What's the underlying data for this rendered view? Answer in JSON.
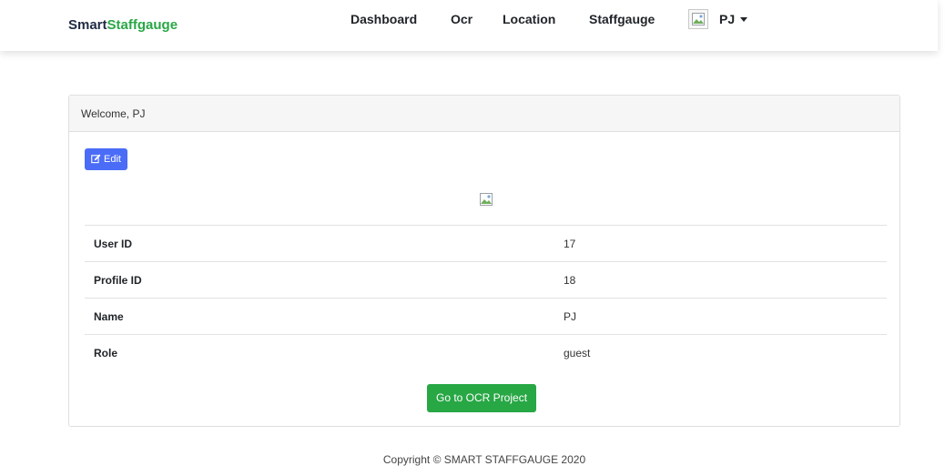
{
  "navbar": {
    "brand_part1": "Smart",
    "brand_part2": "Staffgauge",
    "links": [
      "Dashboard",
      "Ocr",
      "Location",
      "Staffgauge"
    ],
    "user_name": "PJ"
  },
  "card": {
    "header": "Welcome, PJ",
    "edit_label": "Edit",
    "rows": [
      {
        "label": "User ID",
        "value": "17"
      },
      {
        "label": "Profile ID",
        "value": "18"
      },
      {
        "label": "Name",
        "value": "PJ"
      },
      {
        "label": "Role",
        "value": "guest"
      }
    ],
    "go_button_label": "Go to OCR Project"
  },
  "footer": {
    "copyright": "Copyright © SMART STAFFGAUGE 2020"
  },
  "colors": {
    "brand_accent": "#28a745",
    "edit_button": "#4a6cf7",
    "go_button": "#28a745"
  },
  "icons": {
    "edit": "edit-icon",
    "broken_image": "broken-image-icon",
    "dropdown": "caret-down-icon"
  }
}
